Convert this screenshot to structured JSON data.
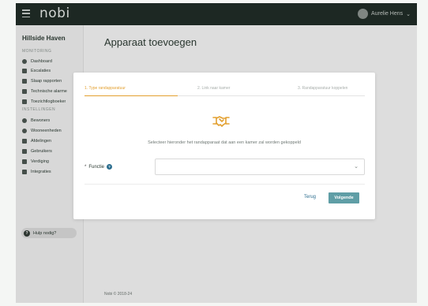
{
  "header": {
    "logo": "nobi",
    "user_name": "Aurelie Hens"
  },
  "sidebar": {
    "facility": "Hillside Haven",
    "section_monitoring": "MONITORING",
    "monitoring_items": [
      {
        "label": "Dashboard",
        "icon": "dashboard-icon"
      },
      {
        "label": "Escalaties",
        "icon": "escalation-icon"
      },
      {
        "label": "Slaap rapporten",
        "icon": "sleep-icon"
      },
      {
        "label": "Technische alarme",
        "icon": "alarm-icon"
      },
      {
        "label": "Toezichtlogboeker",
        "icon": "logbook-icon"
      }
    ],
    "section_instellingen": "INSTELLINGEN",
    "settings_items": [
      {
        "label": "Bewoners",
        "icon": "residents-icon"
      },
      {
        "label": "Wooneenheden",
        "icon": "housing-icon"
      },
      {
        "label": "Afdelingen",
        "icon": "departments-icon"
      },
      {
        "label": "Gebruikers",
        "icon": "users-icon"
      },
      {
        "label": "Verdiging",
        "icon": "building-icon"
      },
      {
        "label": "Integraties",
        "icon": "integrations-icon"
      }
    ],
    "help": "Hulp nodig?"
  },
  "main": {
    "title": "Apparaat toevoegen",
    "footer": "Nobi © 2018-24"
  },
  "modal": {
    "steps": [
      "1. Type randapparatuur",
      "2. Link naar kamer",
      "3. Randapparatuur koppelen"
    ],
    "prompt": "Selecteer hieronder het randapparaat dat aan een kamer zal worden gekoppeld",
    "field_required_mark": "*",
    "field_label": "Functie",
    "field_value": "",
    "back_label": "Terug",
    "next_label": "Volgende"
  },
  "colors": {
    "accent": "#e3a030",
    "primary": "#5f9ea6",
    "topbar": "#1d2a24"
  }
}
